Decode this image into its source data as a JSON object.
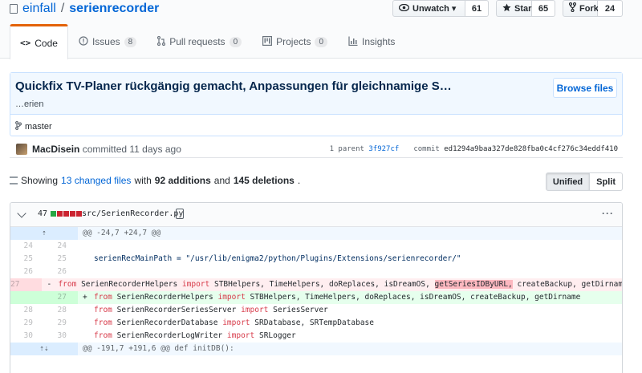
{
  "repo": {
    "owner": "einfall",
    "separator": "/",
    "name": "serienrecorder"
  },
  "actions": [
    {
      "label": "Unwatch ▾",
      "icon": "eye-icon",
      "count": "61"
    },
    {
      "label": "Star",
      "icon": "star-icon",
      "count": "65"
    },
    {
      "label": "Fork",
      "icon": "fork-icon",
      "count": "24"
    }
  ],
  "nav": [
    {
      "label": "Code",
      "icon": "code-icon",
      "counter": ""
    },
    {
      "label": "Issues",
      "icon": "issue-icon",
      "counter": "8"
    },
    {
      "label": "Pull requests",
      "icon": "pull-request-icon",
      "counter": "0"
    },
    {
      "label": "Projects",
      "icon": "project-icon",
      "counter": "0"
    },
    {
      "label": "Insights",
      "icon": "graph-icon",
      "counter": ""
    }
  ],
  "commit": {
    "title": "Quickfix TV-Planer rückgängig gemacht, Anpassungen für gleichnamige S…",
    "description": "…erien",
    "browse_label": "Browse files",
    "branch": "master",
    "author": "MacDisein",
    "committed": "committed 11 days ago",
    "parent_label": "1 parent",
    "parent_sha": "3f927cf",
    "commit_label": "commit",
    "commit_sha": "ed1294a9baa327de828fba0c4cf276c34eddf410"
  },
  "toc": {
    "prefix": "Showing",
    "changed_files": "13 changed files",
    "with": "with",
    "additions": "92 additions",
    "and": "and",
    "deletions": "145 deletions",
    "suffix": "."
  },
  "diffview": {
    "unified": "Unified",
    "split": "Split"
  },
  "file": {
    "count": "47",
    "path": "src/SerienRecorder.py",
    "more": "···",
    "hunk1": "@@ -24,7 +24,7 @@",
    "hunk2": "@@ -191,7 +191,6 @@ def initDB():",
    "lines": [
      {
        "old": "24",
        "new": "24",
        "type": "ctx",
        "sign": "",
        "text": ""
      },
      {
        "old": "25",
        "new": "25",
        "type": "ctx",
        "sign": "",
        "text": "serienRecMainPath = \"/usr/lib/enigma2/python/Plugins/Extensions/serienrecorder/\""
      },
      {
        "old": "26",
        "new": "26",
        "type": "ctx",
        "sign": "",
        "text": ""
      },
      {
        "old": "27",
        "new": "",
        "type": "del",
        "sign": "-",
        "kw1": "from",
        "mod": "SerienRecorderHelpers",
        "kw2": "import",
        "pre": "STBHelpers, TimeHelpers, doReplaces, isDreamOS, ",
        "hl": "getSeriesIDByURL,",
        "post": " createBackup, getDirname"
      },
      {
        "old": "",
        "new": "27",
        "type": "add",
        "sign": "+",
        "kw1": "from",
        "mod": "SerienRecorderHelpers",
        "kw2": "import",
        "pre": "STBHelpers, TimeHelpers, doReplaces, isDreamOS, createBackup, getDirname",
        "hl": "",
        "post": ""
      },
      {
        "old": "28",
        "new": "28",
        "type": "imp",
        "sign": "",
        "kw1": "from",
        "mod": "SerienRecorderSeriesServer",
        "kw2": "import",
        "pre": "SeriesServer",
        "hl": "",
        "post": ""
      },
      {
        "old": "29",
        "new": "29",
        "type": "imp",
        "sign": "",
        "kw1": "from",
        "mod": "SerienRecorderDatabase",
        "kw2": "import",
        "pre": "SRDatabase, SRTempDatabase",
        "hl": "",
        "post": ""
      },
      {
        "old": "30",
        "new": "30",
        "type": "imp",
        "sign": "",
        "kw1": "from",
        "mod": "SerienRecorderLogWriter",
        "kw2": "import",
        "pre": "SRLogger",
        "hl": "",
        "post": ""
      }
    ]
  }
}
